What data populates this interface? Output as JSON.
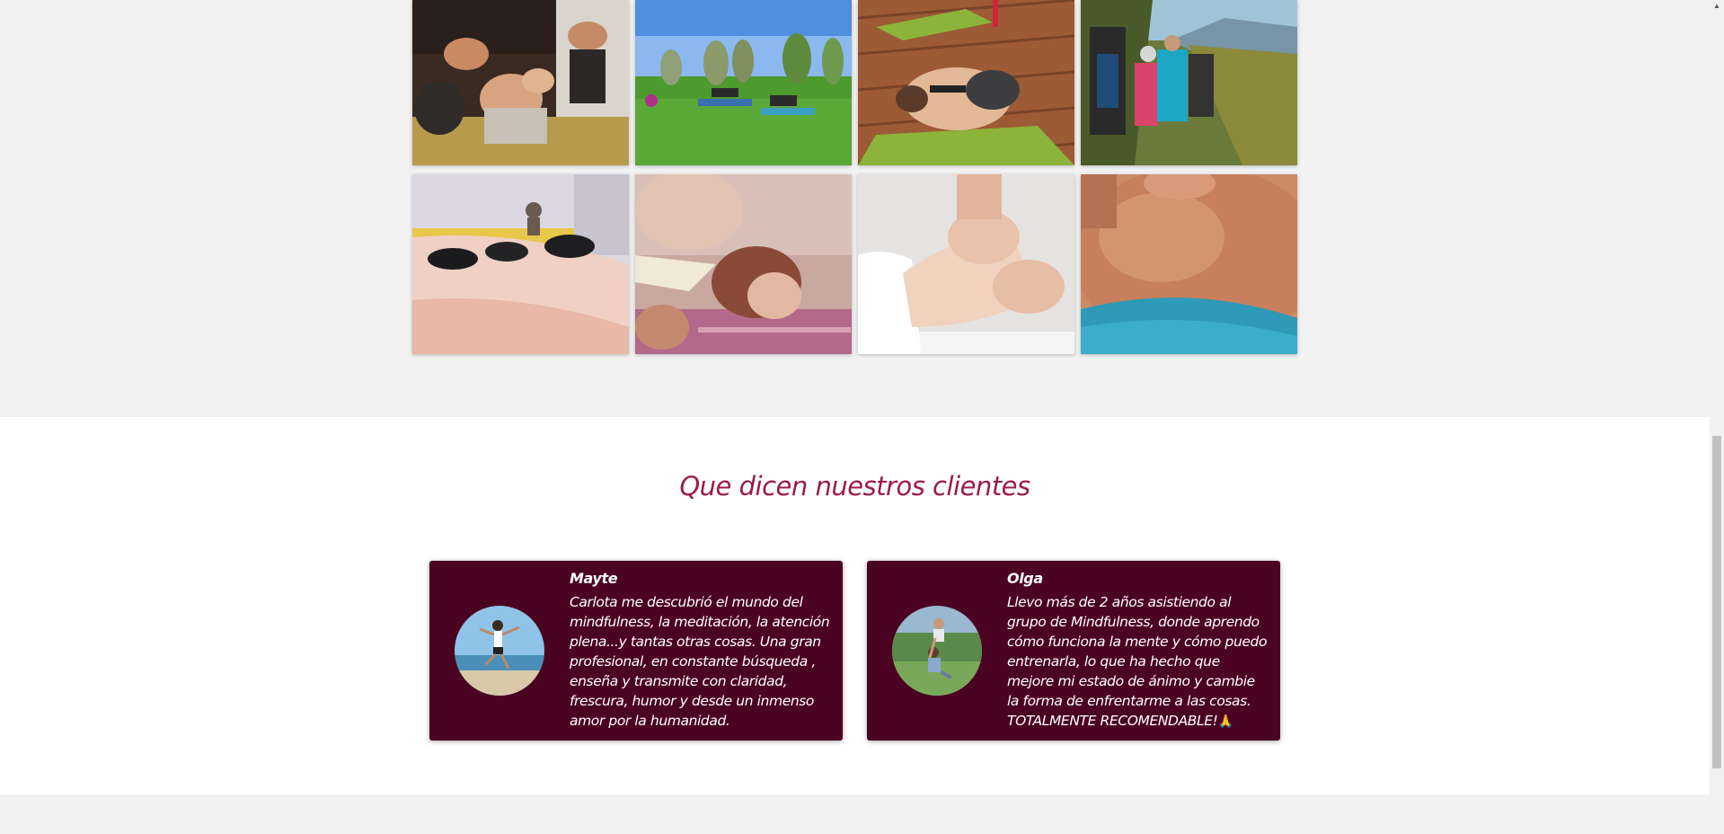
{
  "gallery": {
    "row1": [
      {
        "icon": "yoga-class-photo"
      },
      {
        "icon": "outdoor-yoga-photo"
      },
      {
        "icon": "child-pose-photo"
      },
      {
        "icon": "hiking-group-photo"
      }
    ],
    "row2": [
      {
        "icon": "hot-stones-massage-photo"
      },
      {
        "icon": "relaxing-woman-photo"
      },
      {
        "icon": "foot-massage-photo"
      },
      {
        "icon": "back-massage-photo"
      }
    ]
  },
  "testimonials": {
    "title": "Que dicen nuestros clientes",
    "items": [
      {
        "name": "Mayte",
        "text": "Carlota me descubrió el mundo del mindfulness, la meditación, la atención plena...y tantas otras cosas. Una gran profesional, en constante búsqueda , enseña y transmite con claridad, frescura, humor y desde un inmenso amor por la humanidad.",
        "avatar_icon": "jumping-woman-avatar"
      },
      {
        "name": "Olga",
        "text": "Llevo más de 2 años asistiendo al grupo de Mindfulness, donde aprendo cómo funciona la mente y cómo puedo entrenarla, lo que ha hecho que mejore mi estado de ánimo y cambie la forma de enfrentarme a las cosas. TOTALMENTE RECOMENDABLE!",
        "emoji": "🙏",
        "avatar_icon": "mother-child-avatar"
      }
    ]
  },
  "colors": {
    "title": "#9c1a4b",
    "card_bg": "#4b0322",
    "page_bg": "#f2f2f2",
    "section_bg": "#ffffff"
  },
  "scrollbar": {
    "up_arrow": "▲"
  }
}
